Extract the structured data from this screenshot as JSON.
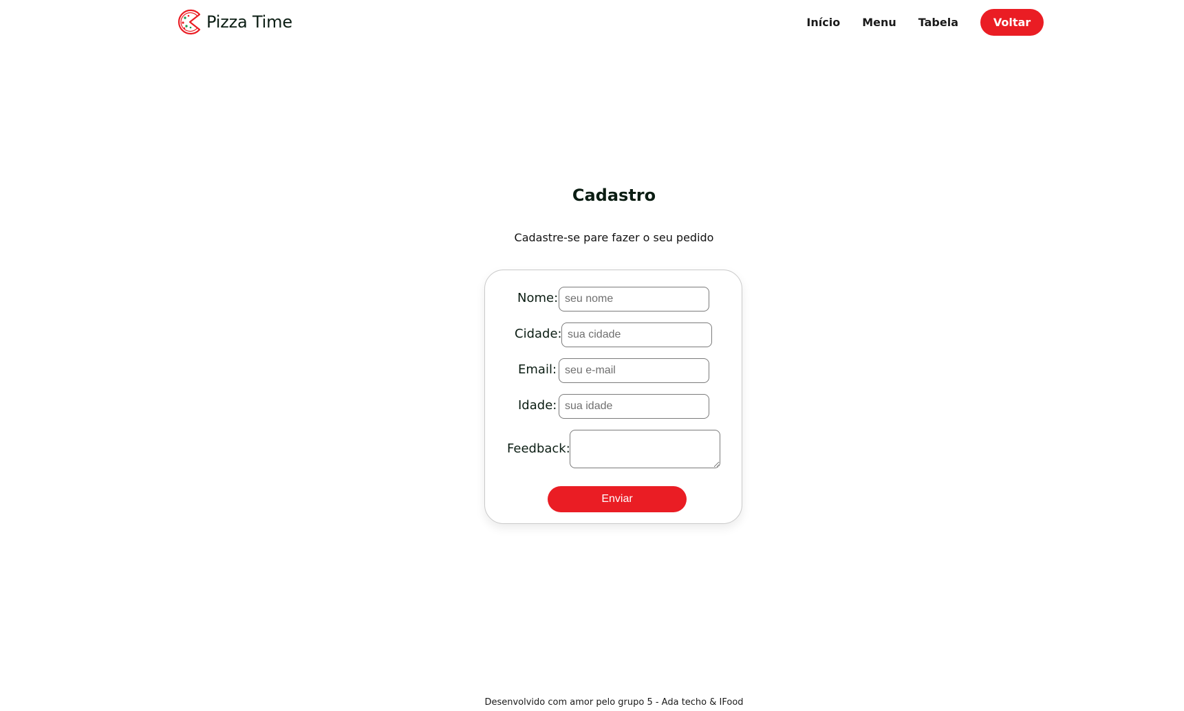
{
  "header": {
    "brand": "Pizza Time",
    "logo_icon": "pizza-logo-icon",
    "nav": {
      "inicio": "Início",
      "menu": "Menu",
      "tabela": "Tabela",
      "voltar": "Voltar"
    }
  },
  "main": {
    "title": "Cadastro",
    "subtitle": "Cadastre-se pare fazer o seu pedido"
  },
  "form": {
    "nome": {
      "label": "Nome:",
      "placeholder": "seu nome",
      "value": ""
    },
    "cidade": {
      "label": "Cidade:",
      "placeholder": "sua cidade",
      "value": ""
    },
    "email": {
      "label": "Email:",
      "placeholder": "seu e-mail",
      "value": ""
    },
    "idade": {
      "label": "Idade:",
      "placeholder": "sua idade",
      "value": ""
    },
    "feedback": {
      "label": "Feedback:",
      "value": ""
    },
    "submit_label": "Enviar"
  },
  "footer": {
    "text": "Desenvolvido com amor pelo grupo 5 - Ada techo & IFood"
  },
  "colors": {
    "accent": "#ea1d24",
    "text_dark": "#0b1d13",
    "card_border": "#c9c9c9"
  }
}
